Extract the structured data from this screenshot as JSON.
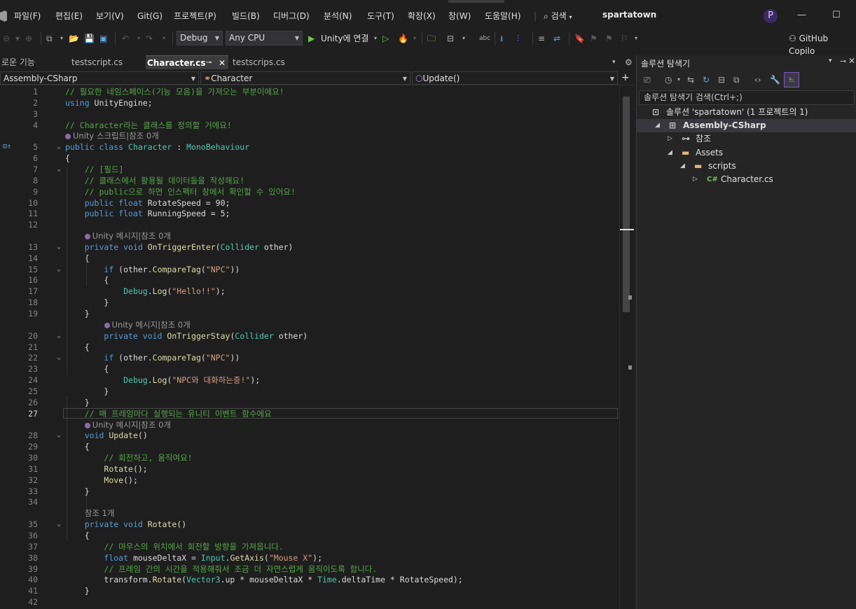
{
  "menu": {
    "items": [
      "파일(F)",
      "편집(E)",
      "보기(V)",
      "Git(G)",
      "프로젝트(P)",
      "빌드(B)",
      "디버그(D)",
      "분석(N)",
      "도구(T)",
      "확장(X)",
      "창(W)",
      "도움말(H)"
    ],
    "search": "검색",
    "solution_name": "spartatown",
    "profile_initial": "P"
  },
  "toolbar": {
    "config": "Debug",
    "platform": "Any CPU",
    "run_label": "Unity에 연결",
    "copilot": "GitHub Copilo"
  },
  "tabs": [
    {
      "label": "로운 기능"
    },
    {
      "label": "testscript.cs"
    },
    {
      "label": "Character.cs",
      "active": true
    },
    {
      "label": "testscrips.cs"
    }
  ],
  "nav": {
    "project": "Assembly-CSharp",
    "class": "Character",
    "member": "Update()"
  },
  "code_lines": [
    {
      "n": "1",
      "parts": [
        [
          "cmt",
          "// 필요한 네임스페이스(기능 모음)을 가져오는 부분이에요!"
        ]
      ]
    },
    {
      "n": "2",
      "parts": [
        [
          "kw",
          "using"
        ],
        [
          "id",
          " UnityEngine;"
        ]
      ]
    },
    {
      "n": "3",
      "parts": []
    },
    {
      "n": "4",
      "parts": [
        [
          "cmt",
          "// Character라는 클래스를 정의할 거에요!"
        ]
      ]
    },
    {
      "n": "",
      "lens": "Unity 스크립트|참조 0개"
    },
    {
      "n": "5",
      "parts": [
        [
          "kw",
          "public class"
        ],
        [
          "id",
          " "
        ],
        [
          "type",
          "Character"
        ],
        [
          "id",
          " : "
        ],
        [
          "type",
          "MonoBehaviour"
        ]
      ]
    },
    {
      "n": "6",
      "parts": [
        [
          "id",
          "{"
        ]
      ]
    },
    {
      "n": "7",
      "parts": [
        [
          "id",
          "    "
        ],
        [
          "cmt",
          "// [필드]"
        ]
      ]
    },
    {
      "n": "8",
      "parts": [
        [
          "id",
          "    "
        ],
        [
          "cmt",
          "// 클래스에서 활용될 데이터들을 작성해요!"
        ]
      ]
    },
    {
      "n": "9",
      "parts": [
        [
          "id",
          "    "
        ],
        [
          "cmt",
          "// public으로 하면 인스펙터 창에서 확인할 수 있어요!"
        ]
      ]
    },
    {
      "n": "10",
      "parts": [
        [
          "id",
          "    "
        ],
        [
          "kw",
          "public float"
        ],
        [
          "id",
          " RotateSpeed = 90;"
        ]
      ]
    },
    {
      "n": "11",
      "parts": [
        [
          "id",
          "    "
        ],
        [
          "kw",
          "public float"
        ],
        [
          "id",
          " RunningSpeed = 5;"
        ]
      ]
    },
    {
      "n": "12",
      "parts": []
    },
    {
      "n": "",
      "lens": "Unity 메시지|참조 0개",
      "indent": "    "
    },
    {
      "n": "13",
      "parts": [
        [
          "id",
          "    "
        ],
        [
          "kw",
          "private void"
        ],
        [
          "id",
          " "
        ],
        [
          "fn",
          "OnTriggerEnter"
        ],
        [
          "id",
          "("
        ],
        [
          "type",
          "Collider"
        ],
        [
          "id",
          " other)"
        ]
      ]
    },
    {
      "n": "14",
      "parts": [
        [
          "id",
          "    {"
        ]
      ]
    },
    {
      "n": "15",
      "parts": [
        [
          "id",
          "        "
        ],
        [
          "kw",
          "if"
        ],
        [
          "id",
          " (other."
        ],
        [
          "fn",
          "CompareTag"
        ],
        [
          "id",
          "("
        ],
        [
          "str",
          "\"NPC\""
        ],
        [
          "id",
          "))"
        ]
      ]
    },
    {
      "n": "16",
      "parts": [
        [
          "id",
          "        {"
        ]
      ]
    },
    {
      "n": "17",
      "parts": [
        [
          "id",
          "            "
        ],
        [
          "type",
          "Debug"
        ],
        [
          "id",
          "."
        ],
        [
          "fn",
          "Log"
        ],
        [
          "id",
          "("
        ],
        [
          "str",
          "\"Hello!!\""
        ],
        [
          "id",
          ");"
        ]
      ]
    },
    {
      "n": "18",
      "parts": [
        [
          "id",
          "        }"
        ]
      ]
    },
    {
      "n": "19",
      "parts": [
        [
          "id",
          "    }"
        ]
      ]
    },
    {
      "n": "",
      "lens": "Unity 메시지|참조 0개",
      "indent": "        "
    },
    {
      "n": "20",
      "parts": [
        [
          "id",
          "        "
        ],
        [
          "kw",
          "private void"
        ],
        [
          "id",
          " "
        ],
        [
          "fn",
          "OnTriggerStay"
        ],
        [
          "id",
          "("
        ],
        [
          "type",
          "Collider"
        ],
        [
          "id",
          " other)"
        ]
      ]
    },
    {
      "n": "21",
      "parts": [
        [
          "id",
          "    {"
        ]
      ]
    },
    {
      "n": "22",
      "parts": [
        [
          "id",
          "        "
        ],
        [
          "kw",
          "if"
        ],
        [
          "id",
          " (other."
        ],
        [
          "fn",
          "CompareTag"
        ],
        [
          "id",
          "("
        ],
        [
          "str",
          "\"NPC\""
        ],
        [
          "id",
          "))"
        ]
      ]
    },
    {
      "n": "23",
      "parts": [
        [
          "id",
          "        {"
        ]
      ]
    },
    {
      "n": "24",
      "parts": [
        [
          "id",
          "            "
        ],
        [
          "type",
          "Debug"
        ],
        [
          "id",
          "."
        ],
        [
          "fn",
          "Log"
        ],
        [
          "id",
          "("
        ],
        [
          "str",
          "\"NPC와 대화하는중!\""
        ],
        [
          "id",
          ");"
        ]
      ]
    },
    {
      "n": "25",
      "parts": [
        [
          "id",
          "        }"
        ]
      ]
    },
    {
      "n": "26",
      "parts": [
        [
          "id",
          "    }"
        ]
      ]
    },
    {
      "n": "27",
      "cur": true,
      "parts": [
        [
          "id",
          "    "
        ],
        [
          "cmt",
          "// 매 프레임마다 실행되는 유니티 이벤트 함수에요"
        ]
      ]
    },
    {
      "n": "",
      "lens": "Unity 메시지|참조 0개",
      "indent": "    "
    },
    {
      "n": "28",
      "parts": [
        [
          "id",
          "    "
        ],
        [
          "kw",
          "void"
        ],
        [
          "id",
          " "
        ],
        [
          "fn",
          "Update"
        ],
        [
          "id",
          "()"
        ]
      ]
    },
    {
      "n": "29",
      "parts": [
        [
          "id",
          "    {"
        ]
      ]
    },
    {
      "n": "30",
      "parts": [
        [
          "id",
          "        "
        ],
        [
          "cmt",
          "// 회전하고, 움직여요!"
        ]
      ]
    },
    {
      "n": "31",
      "parts": [
        [
          "id",
          "        "
        ],
        [
          "fn",
          "Rotate"
        ],
        [
          "id",
          "();"
        ]
      ]
    },
    {
      "n": "32",
      "parts": [
        [
          "id",
          "        "
        ],
        [
          "fn",
          "Move"
        ],
        [
          "id",
          "();"
        ]
      ]
    },
    {
      "n": "33",
      "parts": [
        [
          "id",
          "    }"
        ]
      ]
    },
    {
      "n": "34",
      "parts": []
    },
    {
      "n": "",
      "lens": "참조 1개",
      "indent": "    ",
      "nodot": true
    },
    {
      "n": "35",
      "parts": [
        [
          "id",
          "    "
        ],
        [
          "kw",
          "private void"
        ],
        [
          "id",
          " "
        ],
        [
          "fn",
          "Rotate"
        ],
        [
          "id",
          "()"
        ]
      ]
    },
    {
      "n": "36",
      "parts": [
        [
          "id",
          "    {"
        ]
      ]
    },
    {
      "n": "37",
      "parts": [
        [
          "id",
          "        "
        ],
        [
          "cmt",
          "// 마우스의 위치에서 회전할 방향을 가져옵니다."
        ]
      ]
    },
    {
      "n": "38",
      "parts": [
        [
          "id",
          "        "
        ],
        [
          "kw",
          "float"
        ],
        [
          "id",
          " mouseDeltaX = "
        ],
        [
          "type",
          "Input"
        ],
        [
          "id",
          "."
        ],
        [
          "fn",
          "GetAxis"
        ],
        [
          "id",
          "("
        ],
        [
          "str",
          "\"Mouse X\""
        ],
        [
          "id",
          ");"
        ]
      ]
    },
    {
      "n": "39",
      "parts": [
        [
          "id",
          "        "
        ],
        [
          "cmt",
          "// 프레임 간의 시간을 적용해줘서 조금 더 자연스럽게 움직이도록 합니다."
        ]
      ]
    },
    {
      "n": "40",
      "parts": [
        [
          "id",
          "        transform."
        ],
        [
          "fn",
          "Rotate"
        ],
        [
          "id",
          "("
        ],
        [
          "type",
          "Vector3"
        ],
        [
          "id",
          ".up * mouseDeltaX * "
        ],
        [
          "type",
          "Time"
        ],
        [
          "id",
          ".deltaTime * RotateSpeed);"
        ]
      ]
    },
    {
      "n": "41",
      "parts": [
        [
          "id",
          "    }"
        ]
      ]
    },
    {
      "n": "42",
      "parts": []
    }
  ],
  "solution": {
    "title": "솔루션 탐색기",
    "search_placeholder": "솔루션 탐색기 검색(Ctrl+;)",
    "tree": [
      {
        "label": "솔루션 'spartatown' (1 프로젝트의 1)",
        "level": 0,
        "icon": "solution-icon"
      },
      {
        "label": "Assembly-CSharp",
        "level": 1,
        "icon": "csproj-icon",
        "expanded": true,
        "selected": true,
        "bold": true
      },
      {
        "label": "참조",
        "level": 2,
        "icon": "references-icon",
        "expanded": false
      },
      {
        "label": "Assets",
        "level": 2,
        "icon": "folder-icon",
        "expanded": true
      },
      {
        "label": "scripts",
        "level": 3,
        "icon": "folder-icon",
        "expanded": true
      },
      {
        "label": "Character.cs",
        "level": 4,
        "icon": "csharp-file-icon",
        "expanded": false
      }
    ]
  },
  "colors": {
    "comment": "#57a64a",
    "keyword": "#569cd6",
    "type": "#4ec9b0",
    "string": "#d69d85",
    "accent": "#7e57c2"
  }
}
